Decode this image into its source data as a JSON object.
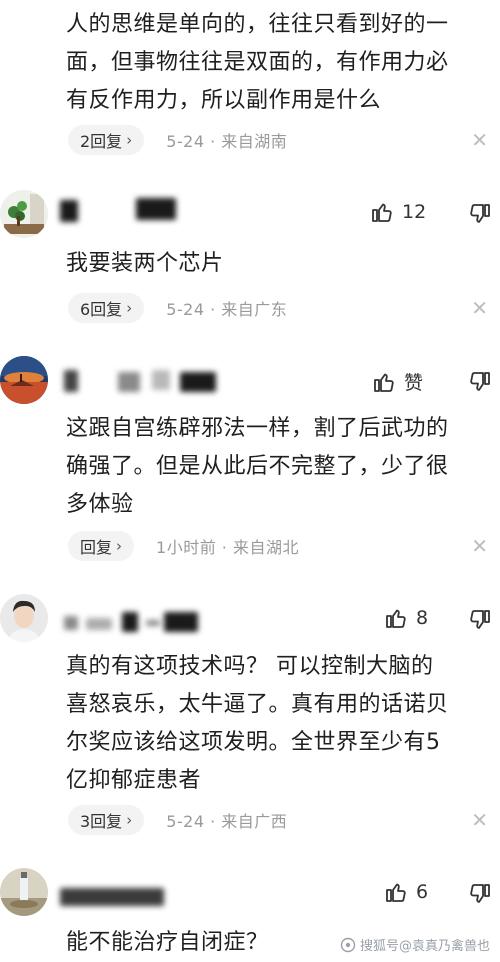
{
  "comments": [
    {
      "content": [
        "人的思维是单向的，往往只看到好的一",
        "面，但事物往往是双面的，有作用力必",
        "有反作用力，所以副作用是什么"
      ],
      "reply_label": "2回复",
      "meta": "5-24 · 来自湖南"
    },
    {
      "likes": "12",
      "content": [
        "我要装两个芯片"
      ],
      "reply_label": "6回复",
      "meta": "5-24 · 来自广东"
    },
    {
      "likes": "赞",
      "content": [
        "这跟自宫练辟邪法一样，割了后武功的",
        "确强了。但是从此后不完整了，少了很",
        "多体验"
      ],
      "reply_label": "回复",
      "meta": "1小时前 · 来自湖北"
    },
    {
      "likes": "8",
      "content": [
        "真的有这项技术吗？ 可以控制大脑的",
        "喜怒哀乐，太牛逼了。真有用的话诺贝",
        "尔奖应该给这项发明。全世界至少有5",
        "亿抑郁症患者"
      ],
      "reply_label": "3回复",
      "meta": "5-24 · 来自广西"
    },
    {
      "likes": "6",
      "content": [
        "能不能治疗自闭症？"
      ]
    }
  ],
  "watermark": "搜狐号@袁真乃禽兽也",
  "icons": {
    "like": "thumbs-up-icon",
    "dislike": "thumbs-down-icon",
    "close": "close-icon",
    "chevron": "chevron-right-icon"
  }
}
